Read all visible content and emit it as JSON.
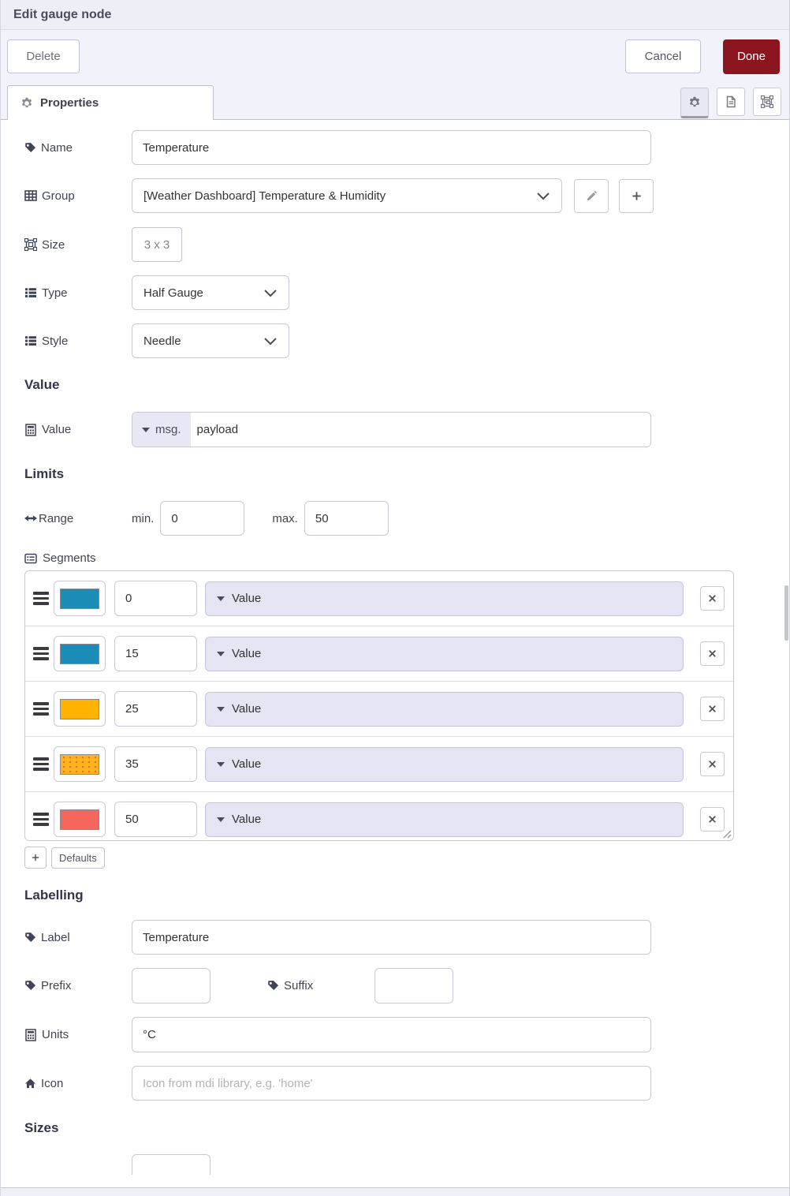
{
  "dialog": {
    "title": "Edit gauge node"
  },
  "toolbar": {
    "delete_label": "Delete",
    "cancel_label": "Cancel",
    "done_label": "Done"
  },
  "tabs": {
    "properties_label": "Properties"
  },
  "fields": {
    "name": {
      "label": "Name",
      "value": "Temperature"
    },
    "group": {
      "label": "Group",
      "value": "[Weather Dashboard] Temperature & Humidity"
    },
    "size": {
      "label": "Size",
      "value": "3 x 3"
    },
    "type": {
      "label": "Type",
      "value": "Half Gauge"
    },
    "style": {
      "label": "Style",
      "value": "Needle"
    }
  },
  "value_section": {
    "heading": "Value",
    "label": "Value",
    "prefix": "msg.",
    "value": "payload"
  },
  "limits_section": {
    "heading": "Limits",
    "range_label": "Range",
    "min_label": "min.",
    "min_value": "0",
    "max_label": "max.",
    "max_value": "50"
  },
  "segments": {
    "label": "Segments",
    "rows": [
      {
        "color": "#1a8cb5",
        "value": "0",
        "mode": "Value",
        "texture": "solid"
      },
      {
        "color": "#1a8cb5",
        "value": "15",
        "mode": "Value",
        "texture": "solid"
      },
      {
        "color": "#ffb300",
        "value": "25",
        "mode": "Value",
        "texture": "solid"
      },
      {
        "color": "#ffb41e",
        "value": "35",
        "mode": "Value",
        "texture": "dotted"
      },
      {
        "color": "#f4675c",
        "value": "50",
        "mode": "Value",
        "texture": "solid"
      }
    ],
    "defaults_label": "Defaults"
  },
  "labelling_section": {
    "heading": "Labelling",
    "label": {
      "label": "Label",
      "value": "Temperature"
    },
    "prefix": {
      "label": "Prefix",
      "value": ""
    },
    "suffix": {
      "label": "Suffix",
      "value": ""
    },
    "units": {
      "label": "Units",
      "value": "°C"
    },
    "icon": {
      "label": "Icon",
      "placeholder": "Icon from mdi library, e.g. 'home'"
    }
  },
  "sizes_section": {
    "heading": "Sizes"
  },
  "colors": {
    "done_button": "#8c1620",
    "segment_blue": "#1a8cb5",
    "segment_orange": "#ffb300",
    "segment_red": "#f4675c"
  }
}
